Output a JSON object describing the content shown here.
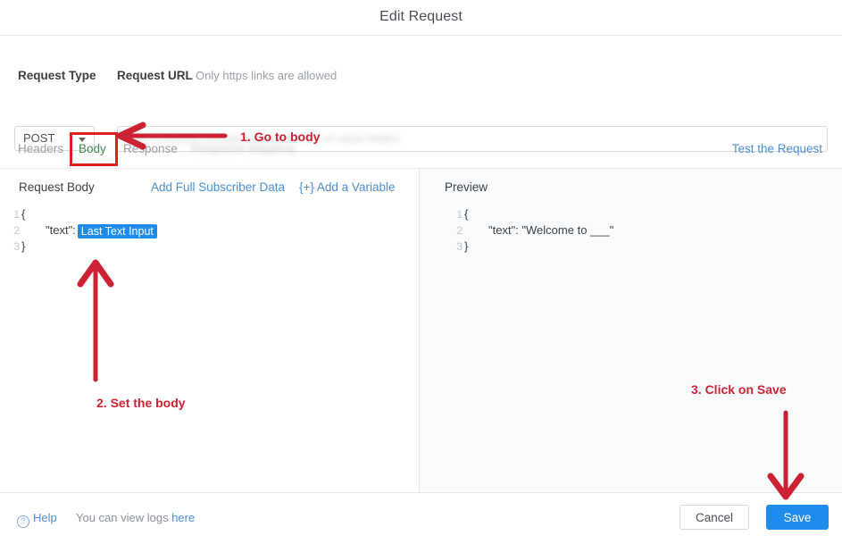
{
  "window": {
    "title": "Edit Request"
  },
  "form": {
    "request_type_label": "Request Type",
    "request_type_value": "POST",
    "request_url_label": "Request URL",
    "request_url_hint": "Only https links are allowed",
    "request_url_value": "https://redacted.example.com/api/blurred-url-value-hidden"
  },
  "tabs": {
    "headers": "Headers",
    "body": "Body",
    "response": "Response",
    "response_mapping": "Response Mapping",
    "test_request": "Test the Request"
  },
  "request_body": {
    "header": "Request Body",
    "add_subscriber_data": "Add Full Subscriber Data",
    "add_variable": "{+} Add a Variable",
    "lines": [
      {
        "num": "1",
        "text": "{",
        "indent": false,
        "chip": null
      },
      {
        "num": "2",
        "text": "\"text\":",
        "indent": true,
        "chip": "Last Text Input"
      },
      {
        "num": "3",
        "text": "}",
        "indent": false,
        "chip": null
      }
    ],
    "line1_num": "1",
    "line1_text": "{",
    "line2_num": "2",
    "line2_text": "\"text\":",
    "line2_chip": "Last Text Input",
    "line3_num": "3",
    "line3_text": "}"
  },
  "preview": {
    "header": "Preview",
    "line1_num": "1",
    "line1_text": "{",
    "line2_num": "2",
    "line2_text": "\"text\": \"Welcome to ___\"",
    "line3_num": "3",
    "line3_text": "}"
  },
  "footer": {
    "help_label": "Help",
    "help_icon_glyph": "?",
    "logs_text": "You can view logs ",
    "logs_link": "here",
    "cancel_label": "Cancel",
    "save_label": "Save"
  },
  "annotations": {
    "step1": "1. Go to body",
    "step2": "2. Set the body",
    "step3": "3. Click on Save"
  },
  "colors": {
    "accent_blue": "#1f8ced",
    "link_blue": "#4a8fd1",
    "annotation_red": "#cc2233",
    "highlight_red": "#e02020",
    "tab_active_green": "#3e8a4f",
    "muted_gray": "#9aa0a6"
  }
}
